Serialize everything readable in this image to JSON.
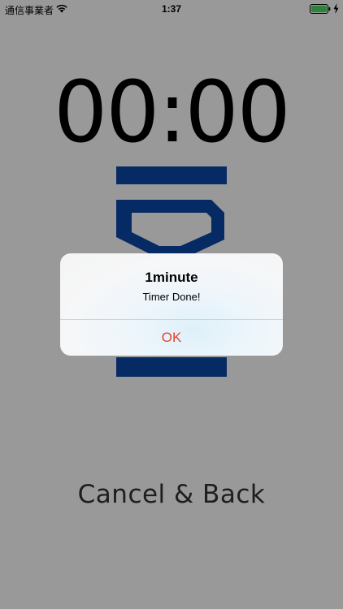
{
  "status_bar": {
    "carrier": "通信事業者",
    "time": "1:37",
    "wifi_icon": "wifi-icon",
    "battery_icon": "battery-icon",
    "charging_icon": "bolt-icon"
  },
  "timer": {
    "value": "00:00"
  },
  "hourglass": {
    "icon": "hourglass-icon",
    "color": "#0a47a5"
  },
  "actions": {
    "cancel_back_label": "Cancel & Back"
  },
  "alert": {
    "title": "1minute",
    "message": "Timer Done!",
    "ok_label": "OK",
    "ok_color": "#e8412d"
  },
  "colors": {
    "battery_fill": "#4cd964",
    "overlay": "rgba(0,0,0,0.4)"
  }
}
